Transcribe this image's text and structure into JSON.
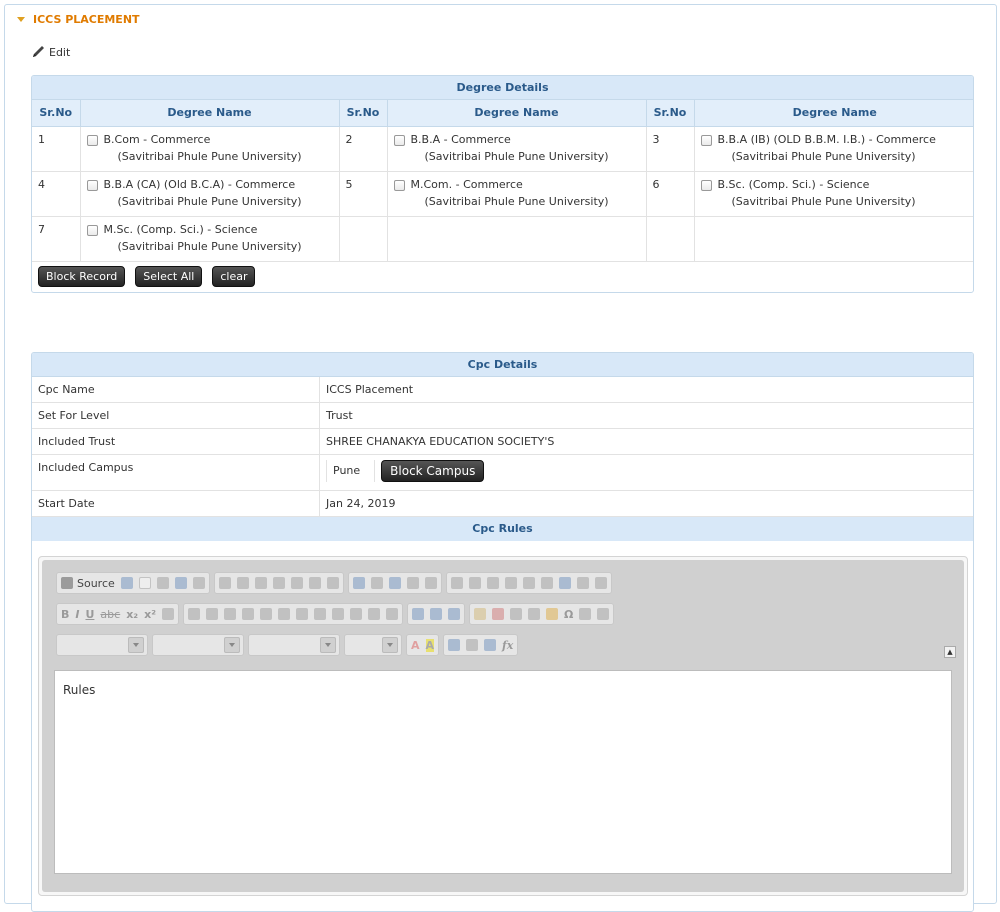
{
  "panel": {
    "title": "ICCS PLACEMENT",
    "edit_label": "Edit"
  },
  "degree_details": {
    "title": "Degree Details",
    "columns": [
      "Sr.No",
      "Degree Name",
      "Sr.No",
      "Degree Name",
      "Sr.No",
      "Degree Name"
    ],
    "rows": [
      [
        {
          "sr": "1",
          "name": "B.Com - Commerce",
          "uni": "(Savitribai Phule Pune University)"
        },
        {
          "sr": "2",
          "name": "B.B.A - Commerce",
          "uni": "(Savitribai Phule Pune University)"
        },
        {
          "sr": "3",
          "name": "B.B.A (IB) (OLD B.B.M. I.B.) - Commerce",
          "uni": "(Savitribai Phule Pune University)"
        }
      ],
      [
        {
          "sr": "4",
          "name": "B.B.A (CA) (Old B.C.A) - Commerce",
          "uni": "(Savitribai Phule Pune University)"
        },
        {
          "sr": "5",
          "name": "M.Com. - Commerce",
          "uni": "(Savitribai Phule Pune University)"
        },
        {
          "sr": "6",
          "name": "B.Sc. (Comp. Sci.) - Science",
          "uni": "(Savitribai Phule Pune University)"
        }
      ],
      [
        {
          "sr": "7",
          "name": "M.Sc. (Comp. Sci.) - Science",
          "uni": "(Savitribai Phule Pune University)"
        }
      ]
    ],
    "buttons": {
      "block_record": "Block Record",
      "select_all": "Select All",
      "clear": "clear"
    }
  },
  "cpc_details": {
    "title": "Cpc Details",
    "cpc_name_label": "Cpc Name",
    "cpc_name_value": "ICCS Placement",
    "level_label": "Set For Level",
    "level_value": "Trust",
    "trust_label": "Included Trust",
    "trust_value": "SHREE CHANAKYA EDUCATION SOCIETY'S",
    "campus_label": "Included Campus",
    "campus_value": "Pune",
    "block_campus_label": "Block Campus",
    "start_label": "Start Date",
    "start_value": "Jan 24, 2019",
    "rules_title": "Cpc Rules"
  },
  "editor": {
    "source_label": "Source",
    "content": "Rules"
  }
}
